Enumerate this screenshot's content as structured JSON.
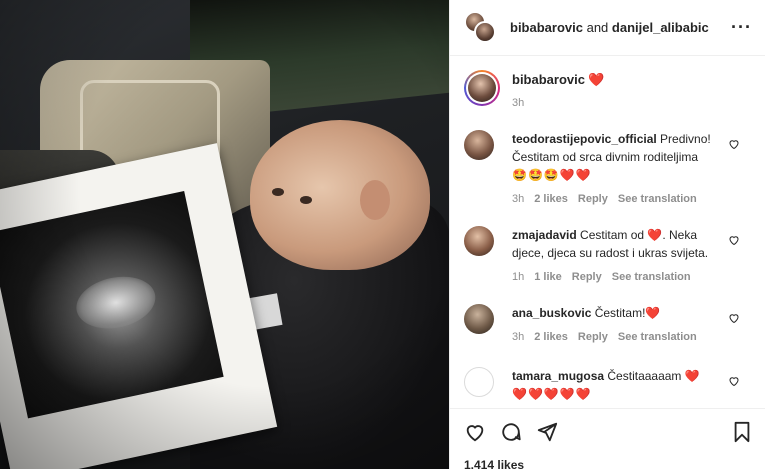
{
  "header": {
    "user1": "bibabarovic",
    "connector": "and",
    "user2": "danijel_alibabic",
    "more_icon": "more-icon"
  },
  "caption": {
    "username": "bibabarovic",
    "text": "❤️",
    "time": "3h"
  },
  "comments": [
    {
      "username": "teodorastijepovic_official",
      "text": "Predivno! Čestitam od srca divnim roditeljima",
      "emojis": "🤩🤩🤩❤️❤️",
      "time": "3h",
      "likes": "2 likes",
      "reply": "Reply",
      "translate": "See translation"
    },
    {
      "username": "zmajadavid",
      "text": "Cestitam od ❤️. Neka djece, djeca su radost i ukras svijeta.",
      "emojis": "",
      "time": "1h",
      "likes": "1 like",
      "reply": "Reply",
      "translate": "See translation"
    },
    {
      "username": "ana_buskovic",
      "text": "Čestitam!❤️",
      "emojis": "",
      "time": "3h",
      "likes": "2 likes",
      "reply": "Reply",
      "translate": "See translation"
    },
    {
      "username": "tamara_mugosa",
      "text": "Čestitaaaaam ❤️",
      "emojis": "❤️❤️❤️❤️❤️",
      "time": "",
      "likes": "",
      "reply": "",
      "translate": ""
    }
  ],
  "footer": {
    "likes": "1,414 likes"
  },
  "colors": {
    "heart_red": "#e0143c",
    "meta_gray": "#8e8e8e",
    "border": "#efefef"
  }
}
